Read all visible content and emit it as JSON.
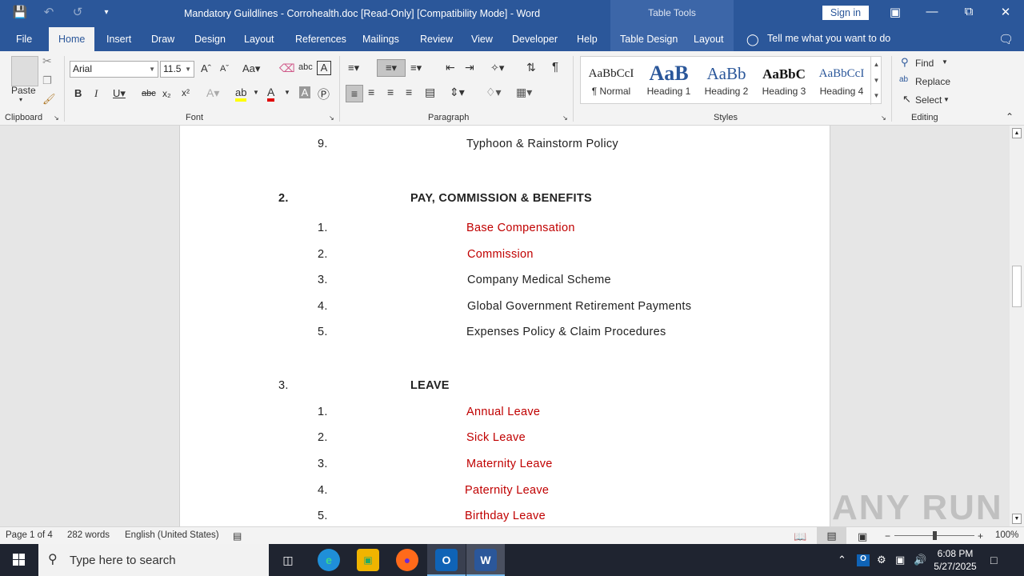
{
  "window": {
    "title": "Mandatory Guildlines - Corrohealth.doc [Read-Only] [Compatibility Mode]  -  Word",
    "context_tab_group": "Table Tools",
    "sign_in": "Sign in"
  },
  "tabs": [
    "File",
    "Home",
    "Insert",
    "Draw",
    "Design",
    "Layout",
    "References",
    "Mailings",
    "Review",
    "View",
    "Developer",
    "Help",
    "Table Design",
    "Layout"
  ],
  "tell_me": "Tell me what you want to do",
  "ribbon": {
    "clipboard": {
      "label": "Clipboard",
      "paste": "Paste"
    },
    "font": {
      "label": "Font",
      "name": "Arial",
      "size": "11.5"
    },
    "paragraph": {
      "label": "Paragraph"
    },
    "styles": {
      "label": "Styles",
      "items": [
        {
          "preview": "AaBbCcI",
          "name": "¶ Normal"
        },
        {
          "preview": "AaB",
          "name": "Heading 1"
        },
        {
          "preview": "AaBb",
          "name": "Heading 2"
        },
        {
          "preview": "AaBbC",
          "name": "Heading 3"
        },
        {
          "preview": "AaBbCcI",
          "name": "Heading 4"
        }
      ]
    },
    "editing": {
      "label": "Editing",
      "find": "Find",
      "replace": "Replace",
      "select": "Select"
    }
  },
  "document": {
    "items": [
      {
        "num": "9.",
        "text": "Typhoon & Rainstorm Policy",
        "red": false
      },
      {
        "num": "2.",
        "text": "PAY, COMMISSION & BENEFITS",
        "heading": true,
        "bold": true
      },
      {
        "num": "1.",
        "text": "Base Compensation",
        "red": true
      },
      {
        "num": "2.",
        "text": "Commission",
        "red": true
      },
      {
        "num": "3.",
        "text": "Company Medical Scheme",
        "red": false
      },
      {
        "num": "4.",
        "text": "Global Government Retirement Payments",
        "red": false
      },
      {
        "num": "5.",
        "text": "Expenses Policy & Claim Procedures",
        "red": false
      },
      {
        "num": "3.",
        "text": "LEAVE",
        "heading": true,
        "bold": false
      },
      {
        "num": "1.",
        "text": "Annual Leave",
        "red": true
      },
      {
        "num": "2.",
        "text": "Sick Leave",
        "red": true
      },
      {
        "num": "3.",
        "text": "Maternity Leave",
        "red": true
      },
      {
        "num": "4.",
        "text": "Paternity Leave",
        "red": true
      },
      {
        "num": "5.",
        "text": "Birthday Leave",
        "red": true
      }
    ]
  },
  "status": {
    "page": "Page 1 of 4",
    "words": "282 words",
    "language": "English (United States)",
    "zoom": "100%"
  },
  "taskbar": {
    "search_placeholder": "Type here to search",
    "time": "6:08 PM",
    "date": "5/27/2025"
  },
  "watermark": "ANY RUN",
  "colors": {
    "word_blue": "#2b579a",
    "red_text": "#c00000"
  }
}
